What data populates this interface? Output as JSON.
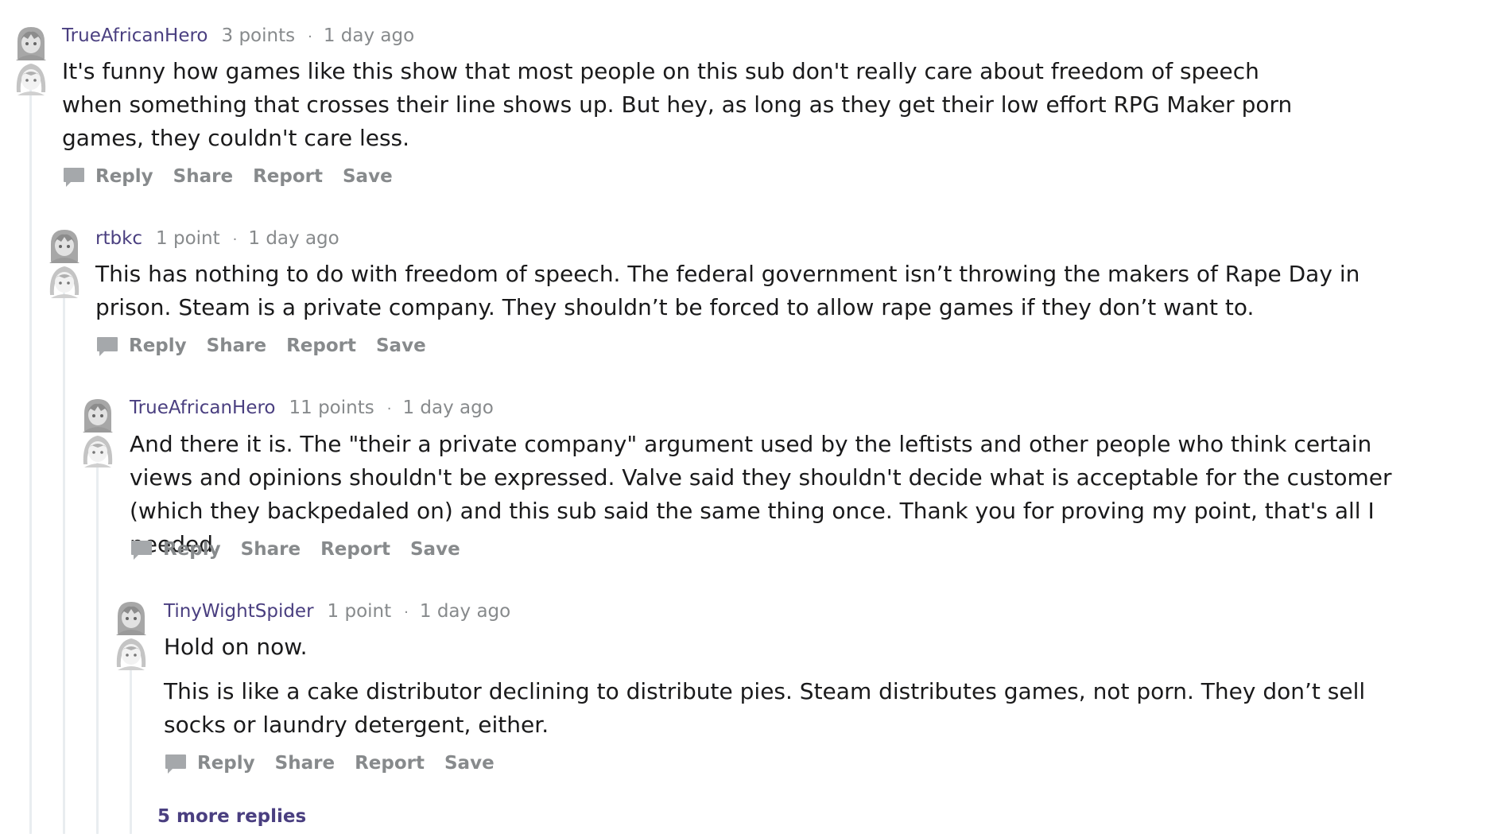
{
  "comments": [
    {
      "author": "TrueAfricanHero",
      "points": "3 points",
      "separator": "·",
      "time": "1 day ago",
      "paragraphs": [
        "It's funny how games like this show that most people on this sub don't really care about freedom of speech when something that crosses their line shows up. But hey, as long as they get their low effort RPG Maker porn games, they couldn't care less."
      ]
    },
    {
      "author": "rtbkc",
      "points": "1 point",
      "separator": "·",
      "time": "1 day ago",
      "paragraphs": [
        "This has nothing to do with freedom of speech. The federal government isn’t throwing the makers of Rape Day in prison. Steam is a private company. They shouldn’t be forced to allow rape games if they don’t want to."
      ]
    },
    {
      "author": "TrueAfricanHero",
      "points": "11 points",
      "separator": "·",
      "time": "1 day ago",
      "paragraphs": [
        "And there it is. The \"their a private company\" argument used by the leftists and other people who think certain views and opinions shouldn't be expressed. Valve said they shouldn't decide what is acceptable for the customer (which they backpedaled on) and this sub said the same thing once. Thank you for proving my point, that's all I needed."
      ]
    },
    {
      "author": "TinyWightSpider",
      "points": "1 point",
      "separator": "·",
      "time": "1 day ago",
      "paragraphs": [
        "Hold on now.",
        "This is like a cake distributor declining to distribute pies. Steam distributes games, not porn. They don’t sell socks or laundry detergent, either."
      ]
    }
  ],
  "actions": {
    "reply": "Reply",
    "share": "Share",
    "report": "Report",
    "save": "Save"
  },
  "more_replies": "5 more replies",
  "icons": {
    "avatar": "anime-avatar-icon",
    "reply": "comment-bubble-icon"
  },
  "colors": {
    "author": "#4a3f80",
    "meta": "#878a8c",
    "thread_line": "#e9edf0",
    "more_replies": "#4a3f80"
  }
}
